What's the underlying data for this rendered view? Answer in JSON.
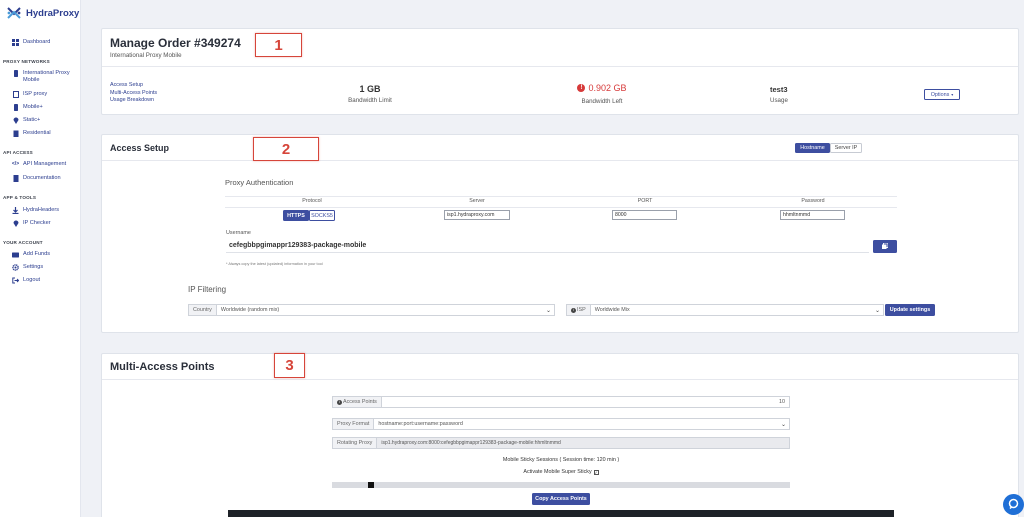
{
  "app": {
    "name": "HydraProxy"
  },
  "sidebar": {
    "items_top": [
      {
        "label": "Dashboard",
        "icon": "grid-icon"
      }
    ],
    "sections": [
      {
        "title": "PROXY NETWORKS",
        "items": [
          {
            "label": "International Proxy Mobile",
            "icon": "phone-icon"
          },
          {
            "label": "ISP proxy",
            "icon": "document-icon"
          },
          {
            "label": "Mobile+",
            "icon": "phone-icon"
          },
          {
            "label": "Static+",
            "icon": "pin-icon"
          },
          {
            "label": "Residential",
            "icon": "building-icon"
          }
        ]
      },
      {
        "title": "API ACCESS",
        "items": [
          {
            "label": "API Management",
            "icon": "code-icon"
          },
          {
            "label": "Documentation",
            "icon": "book-icon"
          }
        ]
      },
      {
        "title": "APP & TOOLS",
        "items": [
          {
            "label": "HydraHeaders",
            "icon": "download-icon"
          },
          {
            "label": "IP Checker",
            "icon": "pin-icon"
          }
        ]
      },
      {
        "title": "YOUR ACCOUNT",
        "items": [
          {
            "label": "Add Funds",
            "icon": "card-icon"
          },
          {
            "label": "Settings",
            "icon": "gear-icon"
          },
          {
            "label": "Logout",
            "icon": "logout-icon"
          }
        ]
      }
    ]
  },
  "order": {
    "title": "Manage Order #349274",
    "subtitle": "International Proxy Mobile",
    "links": [
      "Access Setup",
      "Multi-Access Points",
      "Usage Breakdown"
    ],
    "bandwidth_limit": {
      "value": "1 GB",
      "label": "Bandwidth Limit"
    },
    "bandwidth_left": {
      "value": "0.902 GB",
      "label": "Bandwidth Left"
    },
    "usage": {
      "value": "test3",
      "label": "Usage"
    },
    "options_label": "Options"
  },
  "annotations": [
    "1",
    "2",
    "3"
  ],
  "access": {
    "title": "Access Setup",
    "toggle": {
      "hostname": "Hostname",
      "server_ip": "Server IP"
    },
    "auth_title": "Proxy Authentication",
    "columns": [
      "Protocol",
      "Server",
      "PORT",
      "Password"
    ],
    "protocols": [
      "HTTPS",
      "SOCKS5"
    ],
    "server": "isp1.hydraproxy.com",
    "port": "8000",
    "password": "hhmltnmmd",
    "username_label": "Username",
    "username": "cefegbbpgimappr129383-package-mobile",
    "note": "* Always copy the latest (updated) information in your tool",
    "ip_filtering_title": "IP Filtering",
    "country_label": "Country",
    "country_value": "Worldwide (random mix)",
    "isp_label": "ISP",
    "isp_value": "Worldwide Mix",
    "update_label": "Update settings"
  },
  "multi": {
    "title": "Multi-Access Points",
    "access_points_label": "Access Points",
    "access_points_value": "10",
    "proxy_format_label": "Proxy Format",
    "proxy_format_value": "hostname:port:username:password",
    "rotating_label": "Rotating Proxy",
    "rotating_value": "isp1.hydraproxy.com:8000:cefegbbpgimappr129383-package-mobile:hhmltnmmd",
    "sticky_label": "Mobile Sticky Sessions ( Session time: 120 min )",
    "super_sticky_label": "Activate Mobile Super Sticky",
    "copy_label": "Copy Access Points"
  }
}
